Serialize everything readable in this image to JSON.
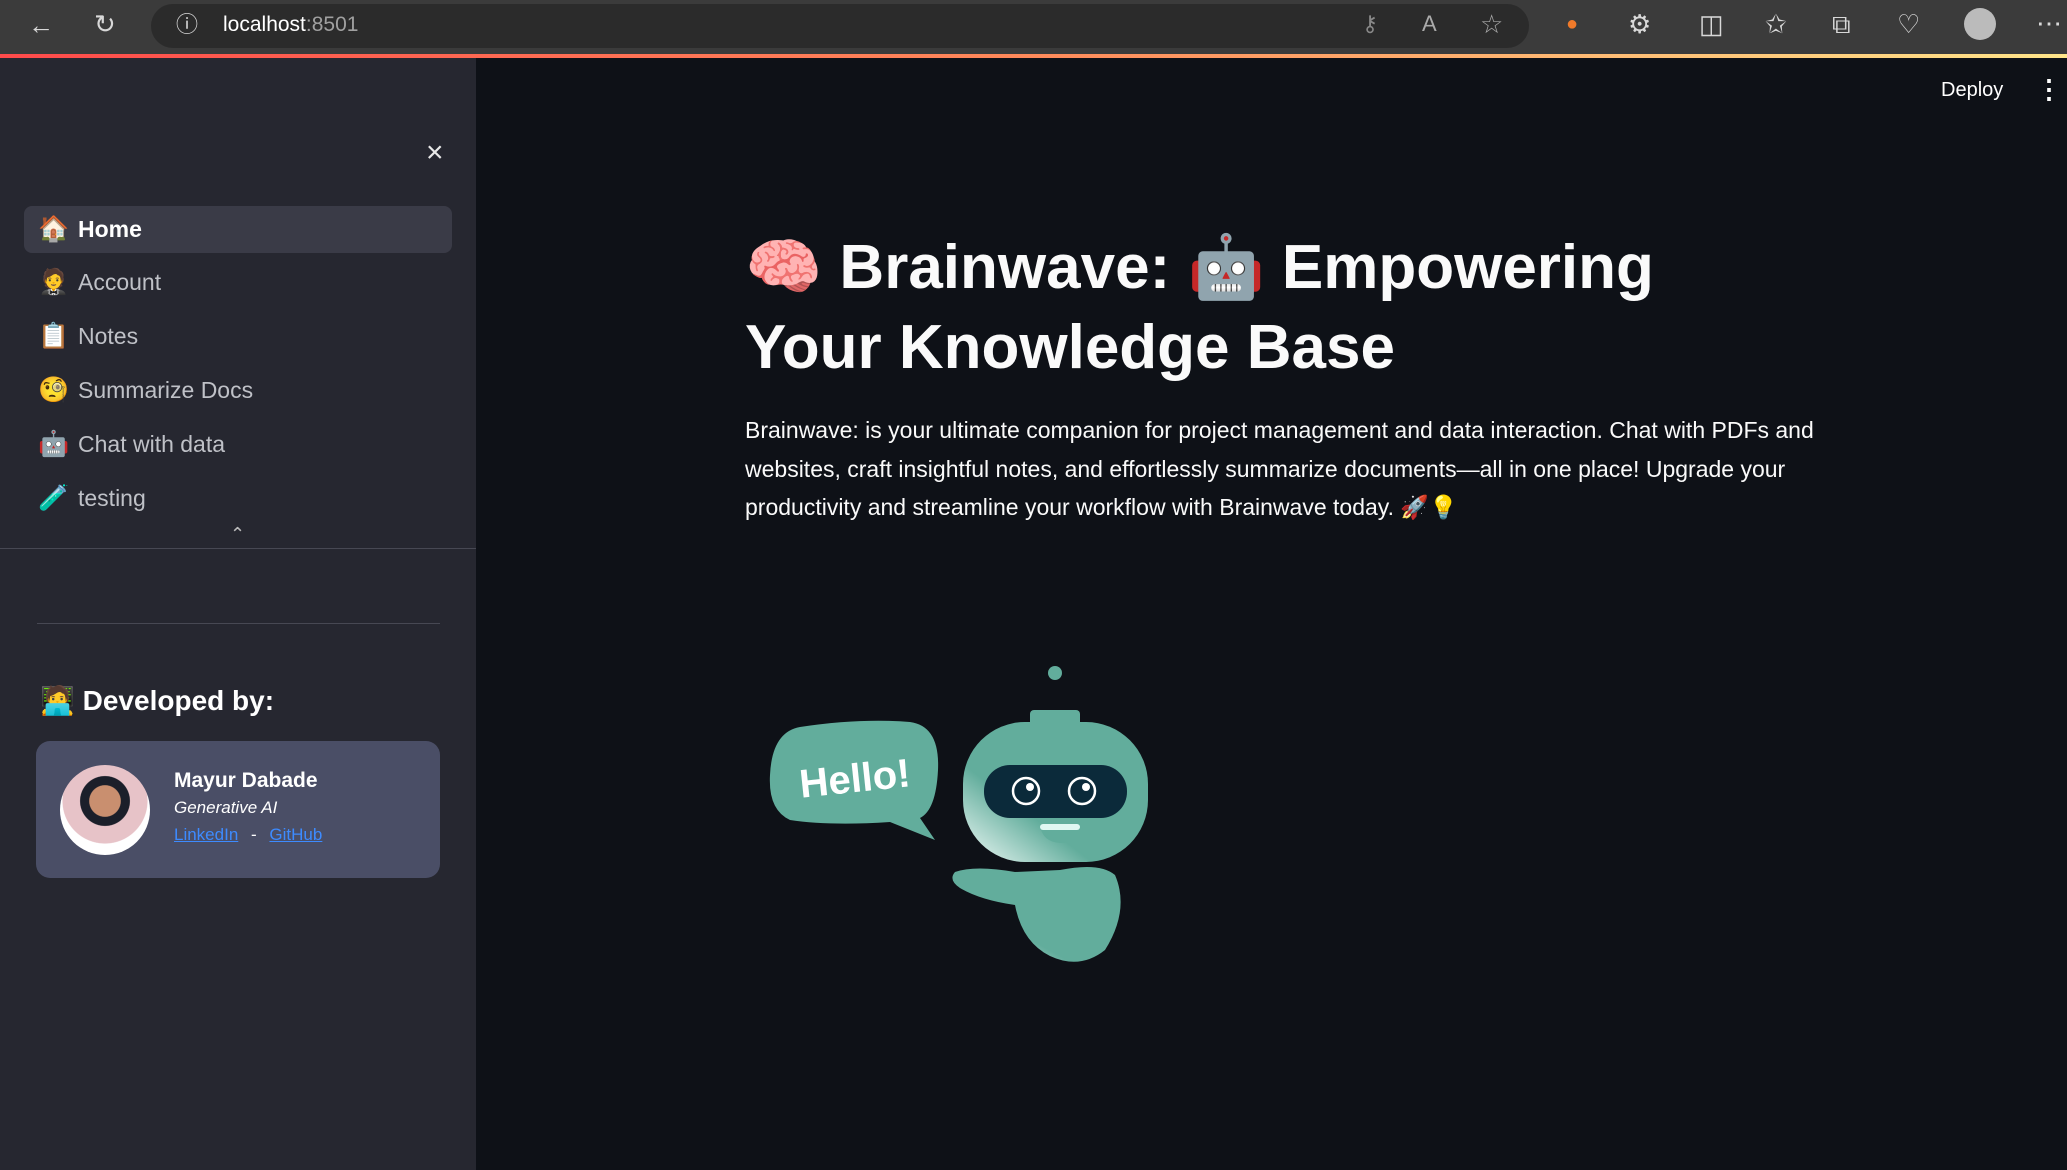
{
  "browser": {
    "url_host": "localhost",
    "url_port": ":8501"
  },
  "sidebar": {
    "close_icon": "×",
    "items": [
      {
        "emoji": "🏠",
        "label": "Home",
        "active": true
      },
      {
        "emoji": "🤵",
        "label": "Account"
      },
      {
        "emoji": "📋",
        "label": "Notes"
      },
      {
        "emoji": "🧐",
        "label": "Summarize Docs"
      },
      {
        "emoji": "🤖",
        "label": "Chat with data"
      },
      {
        "emoji": "🧪",
        "label": "testing"
      }
    ],
    "collapse_chevron": "⌃",
    "developed_by": "🧑‍💻 Developed by:",
    "card": {
      "name": "Mayur Dabade",
      "role": "Generative AI",
      "link1": "LinkedIn",
      "sep": "-",
      "link2": "GitHub"
    }
  },
  "header": {
    "deploy": "Deploy",
    "menu": "⋮"
  },
  "main": {
    "title": "🧠 Brainwave: 🤖 Empowering Your Knowledge Base",
    "description": "Brainwave: is your ultimate companion for project management and data interaction. Chat with PDFs and websites, craft insightful notes, and effortlessly summarize documents—all in one place! Upgrade your productivity and streamline your workflow with Brainwave today. 🚀💡",
    "image_text": "Hello!"
  },
  "colors": {
    "sidebar": "#262730",
    "main": "#0e1117",
    "robot": "#62ad9c",
    "link": "#3d8bff"
  }
}
